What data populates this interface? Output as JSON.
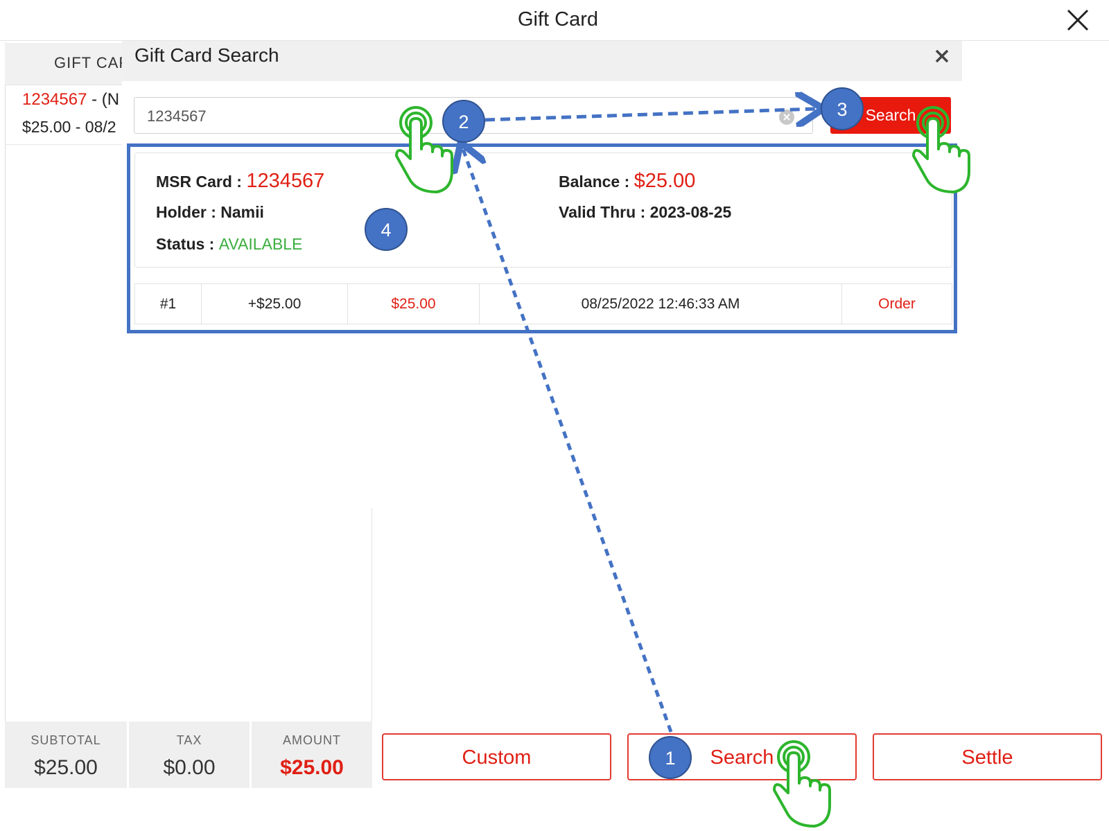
{
  "header": {
    "title": "Gift Card"
  },
  "left_panel": {
    "column_header": "GIFT CAR",
    "gift_card": {
      "number": "1234567",
      "after_number": " - (N",
      "line2": "$25.00 - 08/2"
    }
  },
  "totals": [
    {
      "label": "SUBTOTAL",
      "value": "$25.00"
    },
    {
      "label": "TAX",
      "value": "$0.00"
    },
    {
      "label": "AMOUNT",
      "value": "$25.00"
    }
  ],
  "bottom_buttons": {
    "custom": "Custom",
    "search": "Search",
    "settle": "Settle"
  },
  "modal": {
    "title": "Gift Card Search",
    "search_value": "1234567",
    "search_button": "Search",
    "card": {
      "msr_label": "MSR Card : ",
      "msr_value": "1234567",
      "holder_label": "Holder : ",
      "holder_value": "Namii",
      "status_label": "Status : ",
      "status_value": "AVAILABLE",
      "balance_label": "Balance : ",
      "balance_value": "$25.00",
      "valid_label": "Valid Thru : ",
      "valid_value": "2023-08-25"
    },
    "history": [
      {
        "index": "#1",
        "change": "+$25.00",
        "balance": "$25.00",
        "datetime": "08/25/2022 12:46:33 AM",
        "type": "Order"
      }
    ]
  },
  "annotations": {
    "step1": "1",
    "step2": "2",
    "step3": "3",
    "step4": "4"
  },
  "colors": {
    "accent_red": "#e01f14",
    "status_green": "#3aae3e",
    "annotation_blue": "#4472c4",
    "hand_green": "#2db52d"
  }
}
